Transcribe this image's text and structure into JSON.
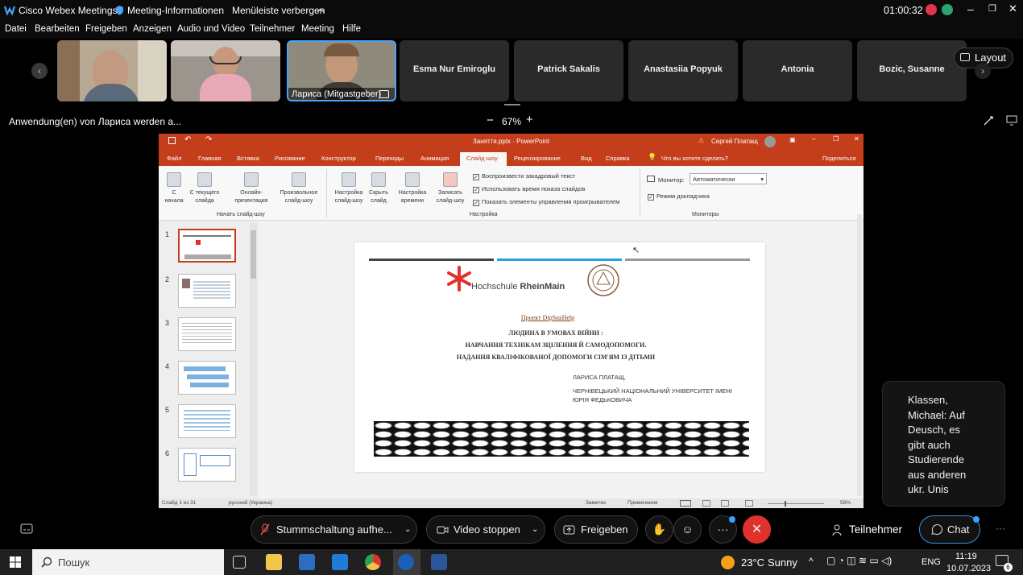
{
  "titlebar": {
    "app_name": "Cisco Webex Meetings",
    "meeting_info": "Meeting-Informationen",
    "hide_menu": "Menüleiste verbergen",
    "timer": "01:00:32"
  },
  "menu": [
    "Datei",
    "Bearbeiten",
    "Freigeben",
    "Anzeigen",
    "Audio und Video",
    "Teilnehmer",
    "Meeting",
    "Hilfe"
  ],
  "participants": {
    "video_tiles": [
      {
        "name": ""
      },
      {
        "name": ""
      },
      {
        "name": "Лариса (Mitgastgeber)"
      }
    ],
    "name_tiles": [
      "Esma Nur Emiroglu",
      "Patrick Sakalis",
      "Anastasiia Popyuk",
      "Antonia",
      "Bozic, Susanne"
    ]
  },
  "layout_button": "Layout",
  "share": {
    "label": "Anwendung(en) von Лариса werden a...",
    "zoom": "67%",
    "minus": "−",
    "plus": "+"
  },
  "ppt": {
    "filename": "Заняття.pptx  ·  PowerPoint",
    "user": "Сергей Платащ",
    "tabs": [
      "Файл",
      "Главная",
      "Вставка",
      "Рисование",
      "Конструктор",
      "Переходы",
      "Анимация",
      "Слайд-шоу",
      "Рецензирование",
      "Вид",
      "Справка"
    ],
    "tell_me": "Что вы хотите сделать?",
    "share_btn": "Поделиться",
    "ribbon": {
      "from_start": "С начала",
      "from_current": "С текущего слайда",
      "online": "Онлайн-презентация",
      "custom": "Произвольное слайд-шоу",
      "group_start": "Начать слайд-шоу",
      "setup": "Настройка слайд-шоу",
      "hide": "Скрыть слайд",
      "timings": "Настройка времени",
      "record": "Записать слайд-шоу",
      "play_narr": "Воспроизвести закадровый текст",
      "use_timings": "Использовать время показа слайдов",
      "show_media": "Показать элементы управления проигрывателем",
      "group_setup": "Настройка",
      "monitor_label": "Монитор:",
      "monitor_value": "Автоматически",
      "presenter": "Режим докладчика",
      "group_monitors": "Мониторы"
    },
    "thumb_numbers": [
      "1",
      "2",
      "3",
      "4",
      "5",
      "6"
    ],
    "slide": {
      "logo_text_1": "Hochschule",
      "logo_text_2": "RheinMain",
      "project": "Проект DipSozHelp",
      "line1": "ЛЮДИНА В УМОВАХ ВІЙНИ :",
      "line2": "НАВЧАННЯ ТЕХНІКАМ ЗЦІЛЕННЯ Й САМОДОПОМОГИ.",
      "line3": "НАДАННЯ КВАЛІФІКОВАНОЇ ДОПОМОГИ  СІМ'ЯМ ІЗ ДІТЬМИ",
      "author": "ЛАРИСА ПЛАТАЩ,",
      "org1": "ЧЕРНІВЕЦЬКИЙ НАЦІОНАЛЬНИЙ УНІВЕРСИТЕТ ІМЕНІ",
      "org2": "ЮРІЯ ФЕДЬКОВИЧА"
    },
    "status": {
      "slide_of": "Слайд 1 из 31",
      "lang": "русский (Украина)",
      "notes": "Заметки",
      "comments": "Примечания",
      "zoom": "58%"
    }
  },
  "chat_popup": [
    "Klassen,",
    "Michael: Auf",
    "Deusch, es",
    "gibt auch",
    "Studierende",
    "aus anderen",
    "ukr. Unis"
  ],
  "controls": {
    "mute": "Stummschaltung aufhe...",
    "video": "Video stoppen",
    "share": "Freigeben",
    "participants": "Teilnehmer",
    "chat": "Chat"
  },
  "taskbar": {
    "search": "Пошук",
    "temp": "23°C",
    "weather": "Sunny",
    "lang": "ENG",
    "time": "11:19",
    "date": "10.07.2023",
    "notif": "6"
  },
  "colors": {
    "ppt_red": "#c43e1c",
    "end_red": "#e0322c",
    "chat_blue": "#3aa0ff"
  }
}
